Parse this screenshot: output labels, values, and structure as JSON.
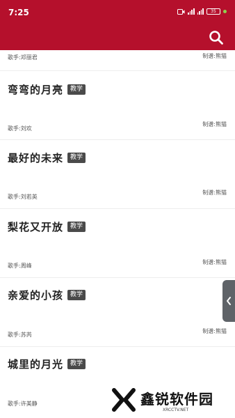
{
  "status_bar": {
    "time": "7:25",
    "battery": "35"
  },
  "app_bar": {
    "search_icon": "search-icon",
    "background": "#b5102c"
  },
  "list": {
    "top_singer": "歌手:邓丽君",
    "top_maker": "制谱:熊猫",
    "songs": [
      {
        "title": "弯弯的月亮",
        "tag": "教学",
        "singer": "歌手:刘欢",
        "maker": "制谱:熊猫"
      },
      {
        "title": "最好的未来",
        "tag": "教学",
        "singer": "歌手:刘若英",
        "maker": "制谱:熊猫"
      },
      {
        "title": "梨花又开放",
        "tag": "教学",
        "singer": "歌手:周峰",
        "maker": "制谱:熊猫"
      },
      {
        "title": "亲爱的小孩",
        "tag": "教学",
        "singer": "歌手:苏芮",
        "maker": "制谱:熊猫"
      },
      {
        "title": "城里的月光",
        "tag": "教学",
        "singer": "歌手:许美静",
        "maker": ""
      }
    ]
  },
  "side_handle_icon": "chevron-left-icon",
  "watermark": {
    "text": "鑫锐软件园",
    "sub": "XRCCTV.NET"
  }
}
